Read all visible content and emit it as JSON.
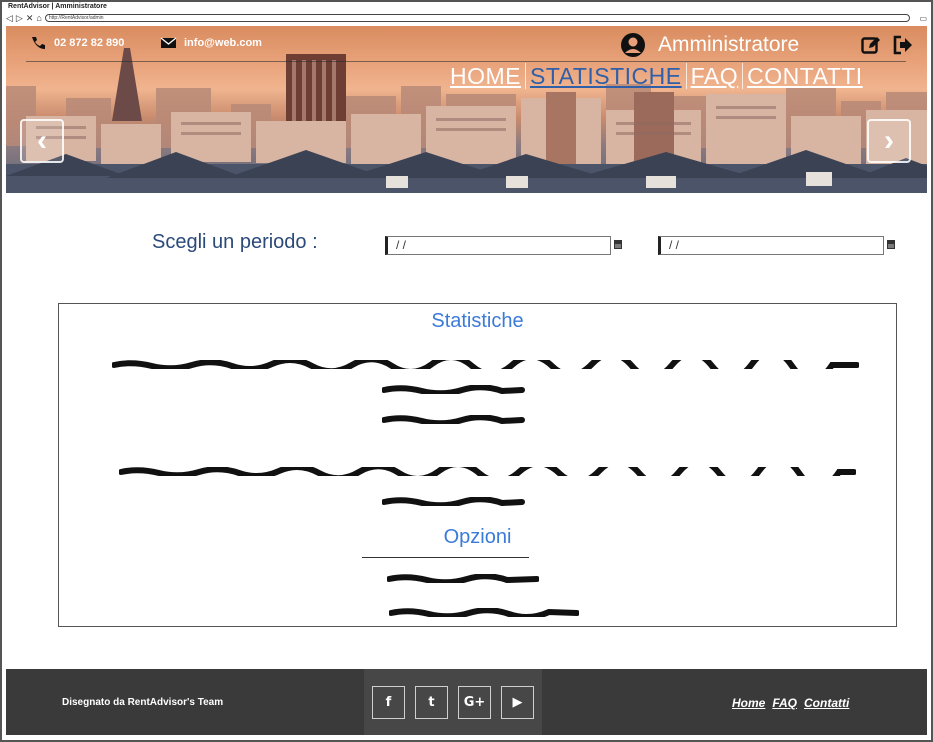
{
  "window": {
    "title": "RentAdvisor | Amministratore",
    "url": "http://RentAdvisor/admin"
  },
  "header": {
    "phone": "02 872 82 890",
    "email": "info@web.com",
    "user_name": "Amministratore",
    "icons": {
      "phone": "phone-icon",
      "mail": "envelope-icon",
      "user": "user-circle-icon",
      "edit": "edit-icon",
      "logout": "logout-icon",
      "prev": "chevron-left-icon",
      "next": "chevron-right-icon"
    },
    "nav": [
      {
        "label": "HOME",
        "active": false
      },
      {
        "label": "STATISTICHE",
        "active": true
      },
      {
        "label": "FAQ",
        "active": false
      },
      {
        "label": "CONTATTI",
        "active": false
      }
    ]
  },
  "period": {
    "label": "Scegli un periodo :",
    "start_value": "/ /",
    "end_value": "/ /"
  },
  "panel": {
    "stats_title": "Statistiche",
    "options_title": "Opzioni"
  },
  "footer": {
    "credit": "Disegnato da RentAdvisor's Team",
    "social": [
      {
        "label": "f",
        "icon": "facebook-icon"
      },
      {
        "label": "t",
        "icon": "twitter-icon"
      },
      {
        "label": "G+",
        "icon": "google-plus-icon"
      },
      {
        "label": "▶",
        "icon": "youtube-icon"
      }
    ],
    "links": [
      "Home",
      "FAQ",
      "Contatti"
    ]
  },
  "colors": {
    "accent_blue": "#3b7bd8",
    "nav_active": "#2f5fa8",
    "label_blue": "#2b4a7a",
    "footer_bg": "#3a3a3a"
  }
}
